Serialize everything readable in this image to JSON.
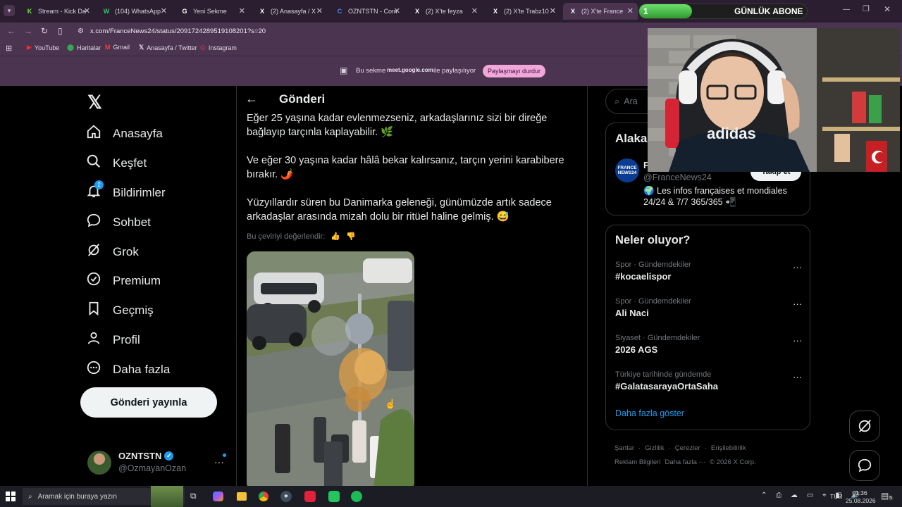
{
  "browser": {
    "tabs": [
      {
        "label": "Stream - Kick Da",
        "fav": "K",
        "color": "#53fc18",
        "active": false
      },
      {
        "label": "(104) WhatsApp",
        "fav": "W",
        "color": "#25d366",
        "active": false
      },
      {
        "label": "Yeni Sekme",
        "fav": "G",
        "color": "#ffffff",
        "active": false
      },
      {
        "label": "(2) Anasayfa / X",
        "fav": "X",
        "color": "#ffffff",
        "active": false
      },
      {
        "label": "OZNTSTN - Com",
        "fav": "C",
        "color": "#4285f4",
        "active": false
      },
      {
        "label": "(2) X'te feyza",
        "fav": "X",
        "color": "#ffffff",
        "active": false
      },
      {
        "label": "(2) X'te Trabz10",
        "fav": "X",
        "color": "#ffffff",
        "active": false
      },
      {
        "label": "(2) X'te France",
        "fav": "X",
        "color": "#ffffff",
        "active": true
      }
    ],
    "url": "x.com/FranceNews24/status/2091724289519108201?s=20",
    "bookmarks": [
      "YouTube",
      "Haritalar",
      "Gmail",
      "Anasayfa / Twitter",
      "Instagram"
    ],
    "share": {
      "prefix": "Bu sekme",
      "domain": "meet.google.com",
      "suffix": "ile paylaşılıyor",
      "stop_label": "Paylaşmayı durdur"
    }
  },
  "overlay": {
    "counter": "1",
    "title": "GÜNLÜK ABONE"
  },
  "nav": {
    "items": [
      {
        "label": "Anasayfa",
        "icon": "home-icon"
      },
      {
        "label": "Keşfet",
        "icon": "search-icon"
      },
      {
        "label": "Bildirimler",
        "icon": "bell-icon",
        "badge": "2"
      },
      {
        "label": "Sohbet",
        "icon": "chat-icon"
      },
      {
        "label": "Grok",
        "icon": "grok-icon"
      },
      {
        "label": "Premium",
        "icon": "premium-icon"
      },
      {
        "label": "Geçmiş",
        "icon": "bookmark-icon"
      },
      {
        "label": "Profil",
        "icon": "person-icon"
      },
      {
        "label": "Daha fazla",
        "icon": "more-circle-icon"
      }
    ],
    "post_button": "Gönderi yayınla",
    "account": {
      "name": "OZNTSTN",
      "handle": "@OzmayanOzan"
    }
  },
  "main": {
    "header": "Gönderi",
    "paragraphs": [
      "Eğer 25 yaşına kadar evlenmezseniz, arkadaşlarınız sizi bir direğe bağlayıp tarçınla kaplayabilir. 🌿",
      "Ve eğer 30 yaşına kadar hâlâ bekar kalırsanız, tarçın yerini karabibere bırakır. 🌶️",
      "Yüzyıllardır süren bu Danimarka geleneği, günümüzde artık sadece arkadaşlar arasında mizah dolu bir ritüel haline gelmiş. 😅"
    ],
    "rate_translation": "Bu çeviriyi değerlendir:"
  },
  "right": {
    "search_placeholder": "Ara",
    "relevant_title": "Alaka",
    "profile": {
      "name": "F",
      "handle": "@FranceNews24",
      "follow_label": "Takip et",
      "bio": "🌍 Les infos françaises et mondiales 24/24 & 7/7 365/365 📲",
      "avatar_text": "FRANCE NEWS24"
    },
    "trends_title": "Neler oluyor?",
    "trends": [
      {
        "meta": "Spor · Gündemdekiler",
        "title": "#kocaelispor"
      },
      {
        "meta": "Spor · Gündemdekiler",
        "title": "Ali Naci"
      },
      {
        "meta": "Siyaset · Gündemdekiler",
        "title": "2026 AGS"
      },
      {
        "meta": "Türkiye tarihinde gündemde",
        "title": "#GalatasarayaOrtaSaha"
      }
    ],
    "show_more": "Daha fazla göster",
    "footer_line1": [
      "Şartlar",
      "Gizlilik",
      "Çerezler",
      "Erişilebilirlik"
    ],
    "footer_line2": [
      "Reklam Bilgileri",
      "Daha fazla ···",
      "© 2026 X Corp."
    ]
  },
  "taskbar": {
    "search_placeholder": "Aramak için buraya yazın",
    "lang": "TUR",
    "time": "01:36",
    "date": "25.08.2026"
  }
}
